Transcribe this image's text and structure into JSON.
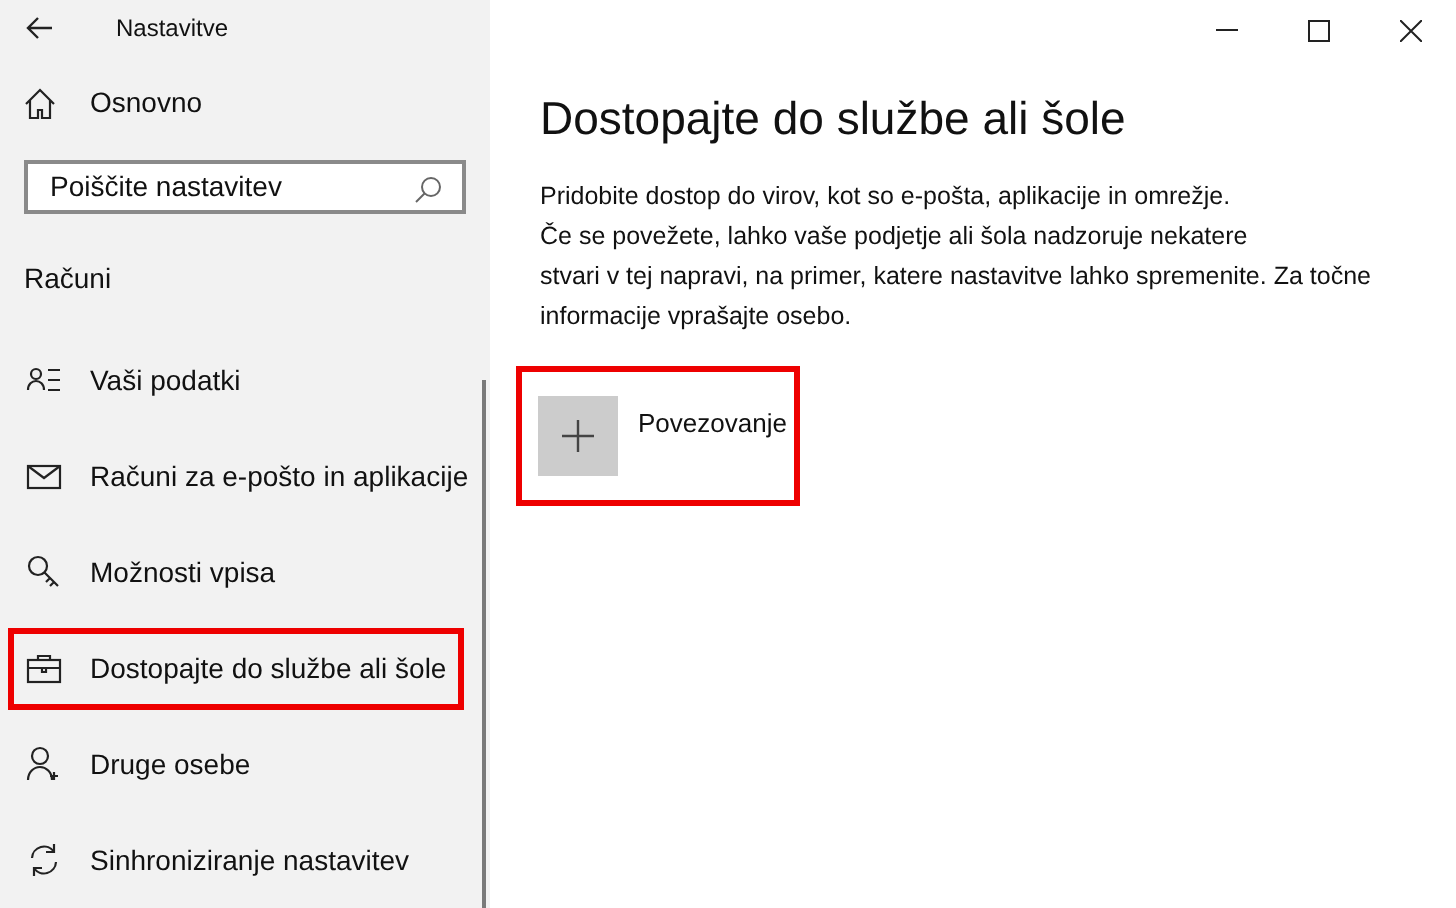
{
  "window": {
    "title": "Nastavitve"
  },
  "sidebar": {
    "home": "Osnovno",
    "search": {
      "placeholder": "Poiščite nastavitev"
    },
    "section": "Računi",
    "items": [
      {
        "kind": "person-list",
        "label": "Vaši podatki",
        "highlighted": false
      },
      {
        "kind": "mail",
        "label": "Računi za e-pošto in aplikacije",
        "highlighted": false
      },
      {
        "kind": "key",
        "label": "Možnosti vpisa",
        "highlighted": false
      },
      {
        "kind": "briefcase",
        "label": "Dostopajte do službe ali šole",
        "highlighted": true
      },
      {
        "kind": "person-add",
        "label": "Druge osebe",
        "highlighted": false
      },
      {
        "kind": "sync",
        "label": "Sinhroniziranje nastavitev",
        "highlighted": false
      }
    ]
  },
  "main": {
    "heading": "Dostopajte do službe ali šole",
    "description": [
      "Pridobite dostop do virov, kot so e-pošta, aplikacije in omrežje.",
      "Če se povežete, lahko vaše podjetje ali šola nadzoruje nekatere",
      "stvari v tej napravi, na primer, katere nastavitve lahko spremenite. Za točne",
      "informacije vprašajte osebo."
    ],
    "connect": {
      "label": "Povezovanje",
      "highlighted": true
    }
  }
}
